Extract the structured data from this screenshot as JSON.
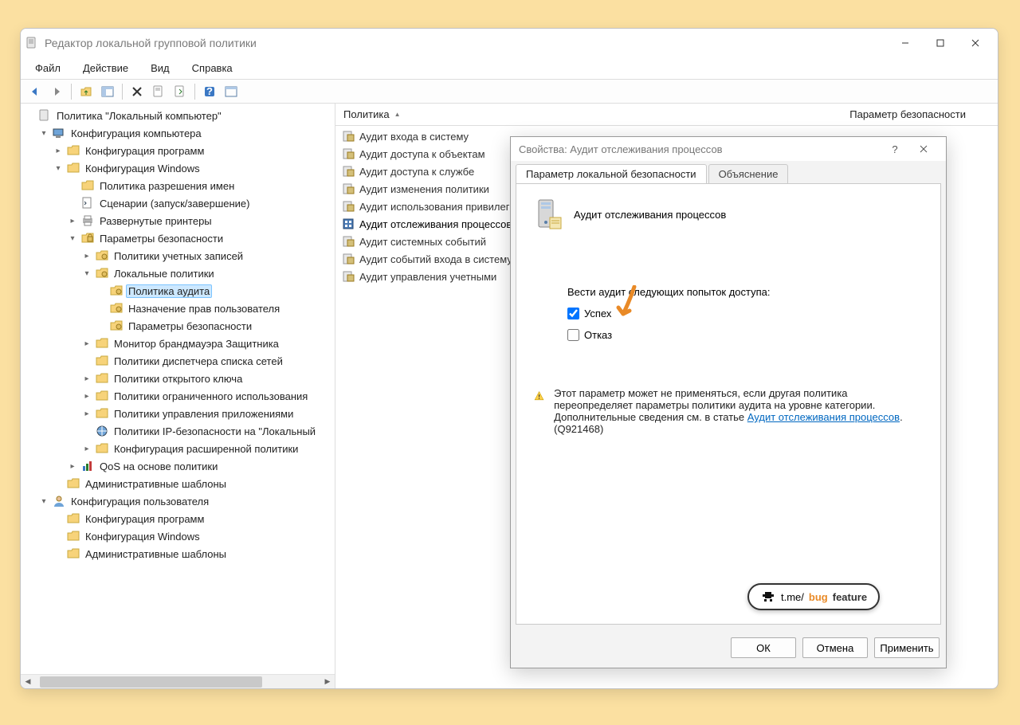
{
  "window": {
    "title": "Редактор локальной групповой политики",
    "menu": {
      "file": "Файл",
      "action": "Действие",
      "view": "Вид",
      "help": "Справка"
    }
  },
  "tree": {
    "root": "Политика \"Локальный компьютер\"",
    "comp_config": "Конфигурация компьютера",
    "prog_config": "Конфигурация программ",
    "win_config": "Конфигурация Windows",
    "name_policy": "Политика разрешения имен",
    "scripts": "Сценарии (запуск/завершение)",
    "printers": "Развернутые принтеры",
    "sec_params": "Параметры безопасности",
    "acct_policies": "Политики учетных записей",
    "local_policies": "Локальные политики",
    "audit_policy": "Политика аудита",
    "rights_assign": "Назначение прав пользователя",
    "sec_params2": "Параметры безопасности",
    "firewall": "Монитор брандмауэра Защитника",
    "netlist": "Политики диспетчера списка сетей",
    "pubkey": "Политики открытого ключа",
    "restricted": "Политики ограниченного использования",
    "appmgmt": "Политики управления приложениями",
    "ipsec": "Политики IP-безопасности на \"Локальный",
    "advaudit": "Конфигурация расширенной политики",
    "qos": "QoS на основе политики",
    "admin_templates": "Административные шаблоны",
    "user_config": "Конфигурация пользователя",
    "user_prog": "Конфигурация программ",
    "user_win": "Конфигурация Windows",
    "user_admin": "Административные шаблоны"
  },
  "list": {
    "col_policy": "Политика",
    "col_setting": "Параметр безопасности",
    "rows": [
      "Аудит входа в систему",
      "Аудит доступа к объектам",
      "Аудит доступа к службе",
      "Аудит изменения политики",
      "Аудит использования привилегий",
      "Аудит отслеживания процессов",
      "Аудит системных событий",
      "Аудит событий входа в систему",
      "Аудит управления учетными"
    ]
  },
  "dialog": {
    "title": "Свойства: Аудит отслеживания процессов",
    "tab_local": "Параметр локальной безопасности",
    "tab_explain": "Объяснение",
    "policy_name": "Аудит отслеживания процессов",
    "attempts_label": "Вести аудит следующих попыток доступа:",
    "success": "Успех",
    "failure": "Отказ",
    "warn_line1": "Этот параметр может не применяться, если другая политика переопределяет параметры политики аудита на уровне категории.",
    "warn_line2_pre": "Дополнительные сведения см. в статье ",
    "warn_link": "Аудит отслеживания процессов",
    "warn_line2_post": ". (Q921468)",
    "ok": "ОК",
    "cancel": "Отмена",
    "apply": "Применить"
  },
  "watermark": {
    "prefix": "t.me/",
    "bug": "bug",
    "feature": "feature"
  }
}
